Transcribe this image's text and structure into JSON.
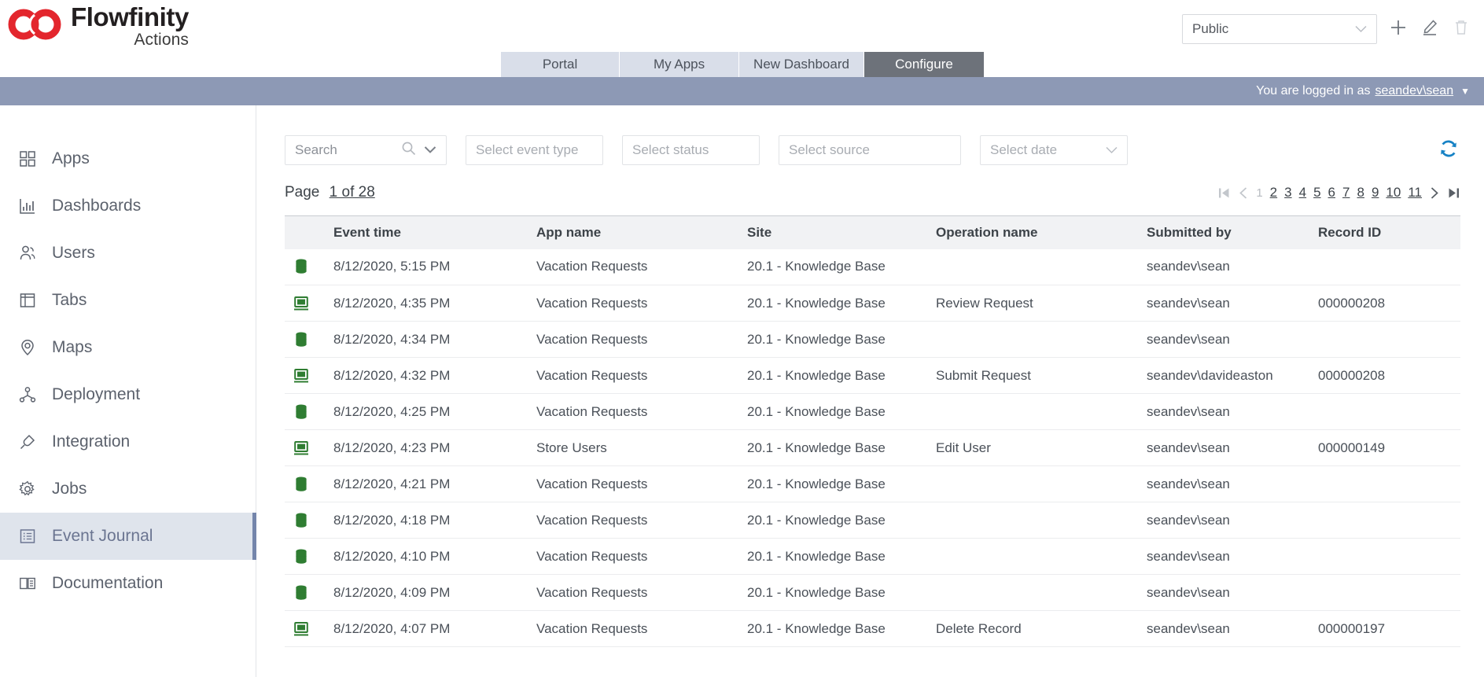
{
  "brand": {
    "title": "Flowfinity",
    "subtitle": "Actions",
    "logo_icon": "interlocking-rings-logo",
    "logo_color": "#e3262d"
  },
  "header": {
    "scope_select": {
      "value": "Public",
      "chevron_icon": "chevron-down-icon"
    },
    "actions": [
      {
        "name": "add-button",
        "icon": "plus-icon",
        "disabled": false
      },
      {
        "name": "edit-button",
        "icon": "pencil-icon",
        "disabled": false
      },
      {
        "name": "delete-button",
        "icon": "trash-icon",
        "disabled": true
      }
    ]
  },
  "tabs": [
    {
      "label": "Portal",
      "active": false
    },
    {
      "label": "My Apps",
      "active": false
    },
    {
      "label": "New Dashboard",
      "active": false
    },
    {
      "label": "Configure",
      "active": true
    }
  ],
  "loginbar": {
    "prefix": "You are logged in as",
    "user": "seandev\\sean",
    "caret_icon": "caret-down-icon"
  },
  "sidebar": {
    "items": [
      {
        "label": "Apps",
        "icon": "grid-icon",
        "active": false
      },
      {
        "label": "Dashboards",
        "icon": "bar-chart-icon",
        "active": false
      },
      {
        "label": "Users",
        "icon": "users-icon",
        "active": false
      },
      {
        "label": "Tabs",
        "icon": "layout-icon",
        "active": false
      },
      {
        "label": "Maps",
        "icon": "map-pin-icon",
        "active": false
      },
      {
        "label": "Deployment",
        "icon": "network-icon",
        "active": false
      },
      {
        "label": "Integration",
        "icon": "plug-icon",
        "active": false
      },
      {
        "label": "Jobs",
        "icon": "gear-icon",
        "active": false
      },
      {
        "label": "Event Journal",
        "icon": "journal-icon",
        "active": true
      },
      {
        "label": "Documentation",
        "icon": "book-icon",
        "active": false
      }
    ]
  },
  "filters": {
    "search": {
      "placeholder": "Search",
      "value": "",
      "search_icon": "search-icon",
      "chevron_icon": "chevron-down-icon"
    },
    "event_type": {
      "placeholder": "Select event type",
      "value": ""
    },
    "status": {
      "placeholder": "Select status",
      "value": ""
    },
    "source": {
      "placeholder": "Select source",
      "value": ""
    },
    "date": {
      "placeholder": "Select date",
      "value": "",
      "chevron_icon": "chevron-down-icon"
    },
    "refresh": {
      "icon": "refresh-icon",
      "color": "#1682c5"
    }
  },
  "pagination": {
    "page_label": "Page",
    "page_value": "1 of 28",
    "first_icon": "first-page-icon",
    "prev_icon": "prev-page-icon",
    "next_icon": "next-page-icon",
    "last_icon": "last-page-icon",
    "current_page": "1",
    "pages": [
      "1",
      "2",
      "3",
      "4",
      "5",
      "6",
      "7",
      "8",
      "9",
      "10",
      "11"
    ]
  },
  "table": {
    "columns": [
      "",
      "Event time",
      "App name",
      "Site",
      "Operation name",
      "Submitted by",
      "Record ID"
    ],
    "rows": [
      {
        "icon": "database-icon",
        "time": "8/12/2020, 5:15 PM",
        "app": "Vacation Requests",
        "site": "20.1 - Knowledge Base",
        "operation": "",
        "submitted_by": "seandev\\sean",
        "record_id": ""
      },
      {
        "icon": "monitor-icon",
        "time": "8/12/2020, 4:35 PM",
        "app": "Vacation Requests",
        "site": "20.1 - Knowledge Base",
        "operation": "Review Request",
        "submitted_by": "seandev\\sean",
        "record_id": "000000208"
      },
      {
        "icon": "database-icon",
        "time": "8/12/2020, 4:34 PM",
        "app": "Vacation Requests",
        "site": "20.1 - Knowledge Base",
        "operation": "",
        "submitted_by": "seandev\\sean",
        "record_id": ""
      },
      {
        "icon": "monitor-icon",
        "time": "8/12/2020, 4:32 PM",
        "app": "Vacation Requests",
        "site": "20.1 - Knowledge Base",
        "operation": "Submit Request",
        "submitted_by": "seandev\\davideaston",
        "record_id": "000000208"
      },
      {
        "icon": "database-icon",
        "time": "8/12/2020, 4:25 PM",
        "app": "Vacation Requests",
        "site": "20.1 - Knowledge Base",
        "operation": "",
        "submitted_by": "seandev\\sean",
        "record_id": ""
      },
      {
        "icon": "monitor-icon",
        "time": "8/12/2020, 4:23 PM",
        "app": "Store Users",
        "site": "20.1 - Knowledge Base",
        "operation": "Edit User",
        "submitted_by": "seandev\\sean",
        "record_id": "000000149"
      },
      {
        "icon": "database-icon",
        "time": "8/12/2020, 4:21 PM",
        "app": "Vacation Requests",
        "site": "20.1 - Knowledge Base",
        "operation": "",
        "submitted_by": "seandev\\sean",
        "record_id": ""
      },
      {
        "icon": "database-icon",
        "time": "8/12/2020, 4:18 PM",
        "app": "Vacation Requests",
        "site": "20.1 - Knowledge Base",
        "operation": "",
        "submitted_by": "seandev\\sean",
        "record_id": ""
      },
      {
        "icon": "database-icon",
        "time": "8/12/2020, 4:10 PM",
        "app": "Vacation Requests",
        "site": "20.1 - Knowledge Base",
        "operation": "",
        "submitted_by": "seandev\\sean",
        "record_id": ""
      },
      {
        "icon": "database-icon",
        "time": "8/12/2020, 4:09 PM",
        "app": "Vacation Requests",
        "site": "20.1 - Knowledge Base",
        "operation": "",
        "submitted_by": "seandev\\sean",
        "record_id": ""
      },
      {
        "icon": "monitor-icon",
        "time": "8/12/2020, 4:07 PM",
        "app": "Vacation Requests",
        "site": "20.1 - Knowledge Base",
        "operation": "Delete Record",
        "submitted_by": "seandev\\sean",
        "record_id": "000000197"
      }
    ]
  },
  "colors": {
    "accent_blue": "#1682c5",
    "active_nav_bg": "#dfe4ec",
    "active_nav_bar": "#7485ab",
    "loginbar_bg": "#8d99b5",
    "tab_inactive_bg": "#d9dee9",
    "tab_active_bg": "#6d727a",
    "row_icon_green": "#2f7d32",
    "brand_red": "#e3262d"
  }
}
